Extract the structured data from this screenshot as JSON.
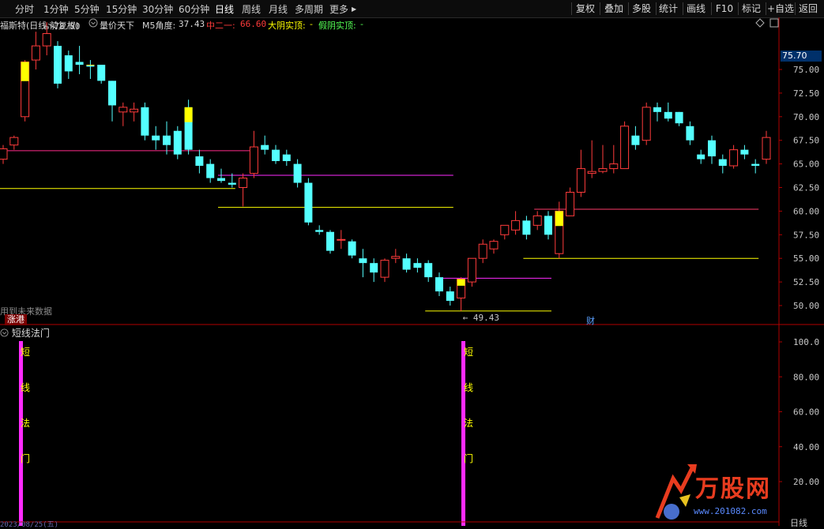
{
  "toolbar": {
    "timeframes": [
      "分时",
      "1分钟",
      "5分钟",
      "15分钟",
      "30分钟",
      "60分钟",
      "日线",
      "周线",
      "月线",
      "多周期",
      "更多"
    ],
    "active_timeframe": "日线",
    "more_arrow": "▶",
    "buttons": [
      "复权",
      "叠加",
      "多股",
      "统计",
      "画线",
      "F10",
      "标记",
      "+自选",
      "返回"
    ]
  },
  "info": {
    "stock": "福斯特(日线,前复权)",
    "indicator_name": "量价天下",
    "m5_label": "M5角度:",
    "m5_value": "37.43",
    "zhong_label": "中二一:",
    "zhong_value": "66.60",
    "dayang_label": "大阴实顶:",
    "dayang_value": "-",
    "jiayin_label": "假阴实顶:",
    "jiayin_value": "-"
  },
  "colors": {
    "up": "#ff3b3b",
    "down": "#54ffff",
    "yellow": "#ffff00",
    "magenta": "#ff2bff",
    "grid": "#7a0000",
    "axis": "#b00000"
  },
  "price_tag": "75.70",
  "price_axis": [
    "75.00",
    "72.50",
    "70.00",
    "67.50",
    "65.00",
    "62.50",
    "60.00",
    "57.50",
    "55.00",
    "52.50",
    "50.00"
  ],
  "high_marker": "78.80",
  "low_marker": "49.43",
  "future_note": "用到未来数据",
  "zhanggang": "涨港",
  "cai": "财",
  "indicator": {
    "title": "短线法门",
    "axis": [
      "100.0",
      "80.00",
      "60.00",
      "40.00",
      "20.00"
    ],
    "signal_chars": [
      "短",
      "线",
      "法",
      "门"
    ]
  },
  "watermark": {
    "brand": "万股网",
    "url": "www.201082.com"
  },
  "bottom_label": "日线",
  "date_start": "2023/08/25(五)",
  "chart_data": {
    "type": "candlestick",
    "y_range": [
      48.5,
      80
    ],
    "candles": [
      {
        "o": 65.5,
        "h": 67.0,
        "l": 65.0,
        "c": 66.6
      },
      {
        "o": 67.0,
        "h": 68.0,
        "l": 66.5,
        "c": 67.8
      },
      {
        "o": 70.0,
        "h": 76.0,
        "l": 69.5,
        "c": 75.8
      },
      {
        "o": 76.0,
        "h": 79.0,
        "l": 75.0,
        "c": 77.5
      },
      {
        "o": 77.5,
        "h": 80.0,
        "l": 76.5,
        "c": 78.8
      },
      {
        "o": 77.5,
        "h": 78.0,
        "l": 73.0,
        "c": 73.5
      },
      {
        "o": 76.5,
        "h": 77.0,
        "l": 74.0,
        "c": 74.8
      },
      {
        "o": 75.8,
        "h": 77.5,
        "l": 74.5,
        "c": 75.5
      },
      {
        "o": 75.5,
        "h": 76.0,
        "l": 74.0,
        "c": 75.3
      },
      {
        "o": 75.5,
        "h": 75.5,
        "l": 73.5,
        "c": 73.8
      },
      {
        "o": 73.8,
        "h": 73.8,
        "l": 69.5,
        "c": 71.2
      },
      {
        "o": 70.5,
        "h": 71.5,
        "l": 69.0,
        "c": 71.0
      },
      {
        "o": 70.5,
        "h": 71.5,
        "l": 69.5,
        "c": 70.8
      },
      {
        "o": 71.0,
        "h": 71.5,
        "l": 67.5,
        "c": 68.0
      },
      {
        "o": 68.0,
        "h": 69.0,
        "l": 66.5,
        "c": 67.5
      },
      {
        "o": 68.0,
        "h": 69.5,
        "l": 66.0,
        "c": 67.0
      },
      {
        "o": 68.5,
        "h": 69.0,
        "l": 65.5,
        "c": 66.0
      },
      {
        "o": 71.0,
        "h": 71.8,
        "l": 66.0,
        "c": 66.5
      },
      {
        "o": 65.8,
        "h": 66.5,
        "l": 64.0,
        "c": 64.8
      },
      {
        "o": 65.0,
        "h": 65.5,
        "l": 63.0,
        "c": 63.5
      },
      {
        "o": 63.5,
        "h": 64.5,
        "l": 63.0,
        "c": 63.2
      },
      {
        "o": 63.0,
        "h": 64.0,
        "l": 62.5,
        "c": 62.8
      },
      {
        "o": 62.5,
        "h": 64.0,
        "l": 60.5,
        "c": 63.5
      },
      {
        "o": 64.0,
        "h": 68.5,
        "l": 63.5,
        "c": 66.8
      },
      {
        "o": 67.0,
        "h": 68.0,
        "l": 66.0,
        "c": 66.5
      },
      {
        "o": 66.5,
        "h": 67.0,
        "l": 65.0,
        "c": 65.3
      },
      {
        "o": 66.0,
        "h": 66.5,
        "l": 64.8,
        "c": 65.3
      },
      {
        "o": 65.0,
        "h": 65.5,
        "l": 62.5,
        "c": 63.0
      },
      {
        "o": 63.0,
        "h": 63.5,
        "l": 58.5,
        "c": 58.8
      },
      {
        "o": 58.0,
        "h": 58.5,
        "l": 57.5,
        "c": 57.8
      },
      {
        "o": 57.8,
        "h": 58.0,
        "l": 55.5,
        "c": 55.8
      },
      {
        "o": 57.0,
        "h": 58.0,
        "l": 56.0,
        "c": 57.0
      },
      {
        "o": 56.8,
        "h": 57.0,
        "l": 55.0,
        "c": 55.3
      },
      {
        "o": 55.0,
        "h": 56.0,
        "l": 53.0,
        "c": 54.5
      },
      {
        "o": 54.5,
        "h": 55.0,
        "l": 52.5,
        "c": 53.5
      },
      {
        "o": 53.0,
        "h": 55.0,
        "l": 52.5,
        "c": 54.8
      },
      {
        "o": 55.0,
        "h": 56.0,
        "l": 54.5,
        "c": 55.2
      },
      {
        "o": 55.0,
        "h": 55.5,
        "l": 53.5,
        "c": 53.8
      },
      {
        "o": 54.5,
        "h": 55.0,
        "l": 53.5,
        "c": 54.0
      },
      {
        "o": 54.5,
        "h": 54.8,
        "l": 52.5,
        "c": 53.0
      },
      {
        "o": 53.0,
        "h": 53.5,
        "l": 51.0,
        "c": 51.5
      },
      {
        "o": 51.5,
        "h": 52.0,
        "l": 50.0,
        "c": 50.5
      },
      {
        "o": 50.8,
        "h": 53.0,
        "l": 49.43,
        "c": 52.8
      },
      {
        "o": 52.5,
        "h": 55.0,
        "l": 52.0,
        "c": 55.0
      },
      {
        "o": 55.0,
        "h": 57.0,
        "l": 54.5,
        "c": 56.5
      },
      {
        "o": 56.0,
        "h": 57.0,
        "l": 55.5,
        "c": 56.8
      },
      {
        "o": 57.5,
        "h": 58.5,
        "l": 57.0,
        "c": 58.5
      },
      {
        "o": 58.0,
        "h": 60.0,
        "l": 57.5,
        "c": 59.0
      },
      {
        "o": 59.0,
        "h": 59.5,
        "l": 57.0,
        "c": 57.5
      },
      {
        "o": 58.5,
        "h": 60.0,
        "l": 58.0,
        "c": 59.5
      },
      {
        "o": 59.5,
        "h": 60.0,
        "l": 57.0,
        "c": 57.5
      },
      {
        "o": 55.5,
        "h": 61.0,
        "l": 55.0,
        "c": 60.0
      },
      {
        "o": 59.5,
        "h": 62.5,
        "l": 59.5,
        "c": 62.0
      },
      {
        "o": 62.0,
        "h": 66.5,
        "l": 61.5,
        "c": 64.5
      },
      {
        "o": 64.0,
        "h": 67.5,
        "l": 63.5,
        "c": 64.2
      },
      {
        "o": 64.2,
        "h": 67.0,
        "l": 64.0,
        "c": 64.5
      },
      {
        "o": 64.5,
        "h": 67.0,
        "l": 64.0,
        "c": 65.0
      },
      {
        "o": 64.5,
        "h": 69.5,
        "l": 64.5,
        "c": 69.0
      },
      {
        "o": 68.0,
        "h": 69.0,
        "l": 66.5,
        "c": 67.0
      },
      {
        "o": 67.5,
        "h": 71.5,
        "l": 67.0,
        "c": 71.0
      },
      {
        "o": 71.0,
        "h": 71.5,
        "l": 69.5,
        "c": 70.5
      },
      {
        "o": 70.5,
        "h": 71.5,
        "l": 69.5,
        "c": 69.8
      },
      {
        "o": 70.5,
        "h": 70.5,
        "l": 69.0,
        "c": 69.3
      },
      {
        "o": 69.0,
        "h": 69.5,
        "l": 67.0,
        "c": 67.5
      },
      {
        "o": 66.0,
        "h": 66.5,
        "l": 65.0,
        "c": 65.5
      },
      {
        "o": 67.5,
        "h": 68.0,
        "l": 65.0,
        "c": 65.8
      },
      {
        "o": 65.5,
        "h": 66.0,
        "l": 64.0,
        "c": 64.8
      },
      {
        "o": 64.8,
        "h": 67.0,
        "l": 64.5,
        "c": 66.5
      },
      {
        "o": 66.5,
        "h": 67.0,
        "l": 65.5,
        "c": 66.0
      },
      {
        "o": 65.0,
        "h": 65.5,
        "l": 64.0,
        "c": 64.8
      },
      {
        "o": 65.5,
        "h": 68.5,
        "l": 65.0,
        "c": 67.8
      }
    ],
    "levels": [
      {
        "y": 66.4,
        "color": "#ff2b8a",
        "x_from": 0,
        "x_to": 23
      },
      {
        "y": 62.4,
        "color": "#ffff00",
        "x_from": 0,
        "x_to": 21
      },
      {
        "y": 63.8,
        "color": "#ff2bff",
        "x_from": 20,
        "x_to": 41
      },
      {
        "y": 60.4,
        "color": "#ffff00",
        "x_from": 20,
        "x_to": 41
      },
      {
        "y": 52.9,
        "color": "#ff2bff",
        "x_from": 40,
        "x_to": 50
      },
      {
        "y": 49.43,
        "color": "#ffff00",
        "x_from": 39,
        "x_to": 50
      },
      {
        "y": 60.2,
        "color": "#ff3b6a",
        "x_from": 49,
        "x_to": 69
      },
      {
        "y": 55.0,
        "color": "#ffff00",
        "x_from": 48,
        "x_to": 69
      }
    ],
    "signals": [
      1,
      41
    ]
  }
}
